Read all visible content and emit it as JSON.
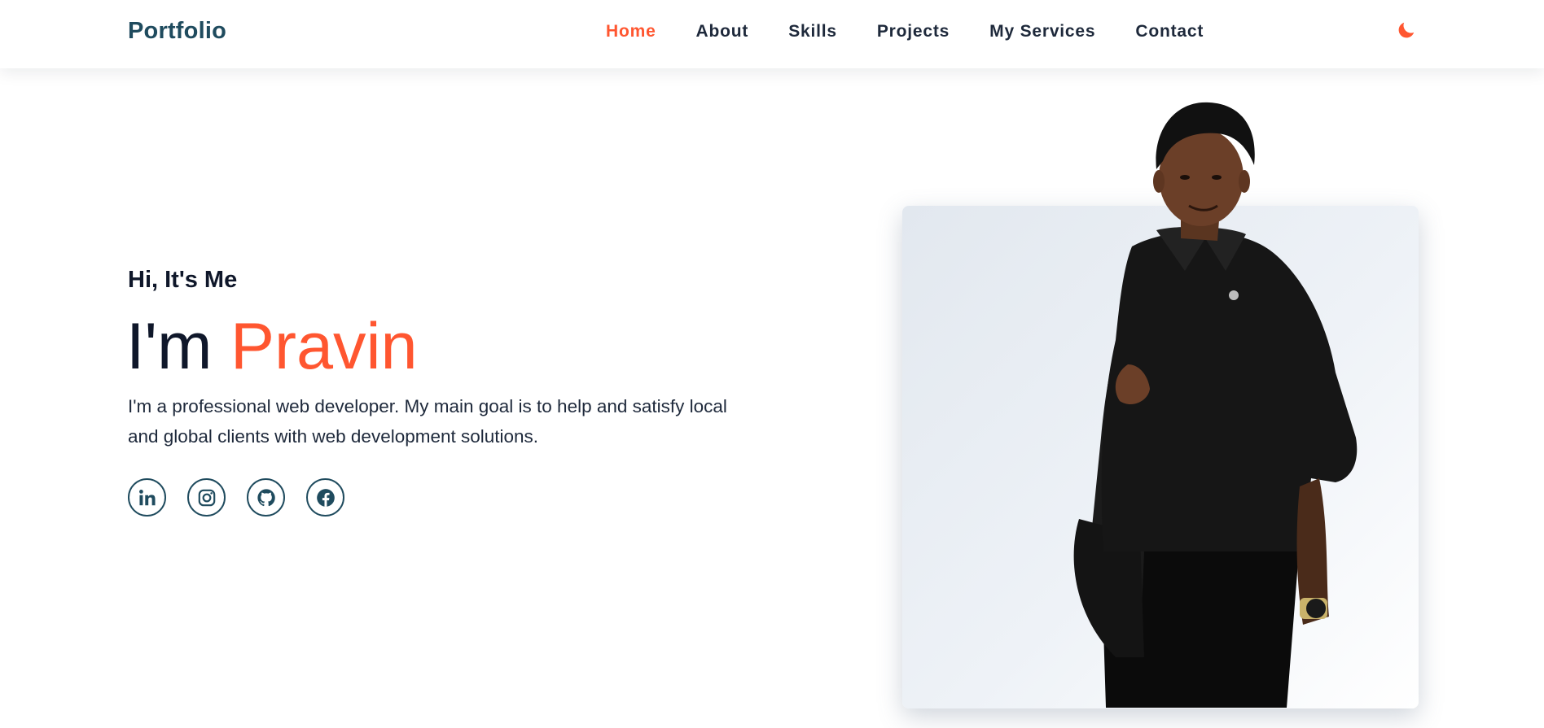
{
  "nav": {
    "logo": "Portfolio",
    "links": [
      {
        "label": "Home",
        "active": true
      },
      {
        "label": "About",
        "active": false
      },
      {
        "label": "Skills",
        "active": false
      },
      {
        "label": "Projects",
        "active": false
      },
      {
        "label": "My Services",
        "active": false
      },
      {
        "label": "Contact",
        "active": false
      }
    ],
    "theme_toggle_icon": "moon-icon"
  },
  "hero": {
    "greeting": "Hi, It's Me",
    "title_prefix": "I'm ",
    "name": "Pravin",
    "description": "I'm a professional web developer. My main goal is to help and satisfy local and global clients with web development solutions.",
    "socials": [
      {
        "icon": "linkedin-icon"
      },
      {
        "icon": "instagram-icon"
      },
      {
        "icon": "github-icon"
      },
      {
        "icon": "facebook-icon"
      }
    ],
    "photo_icon": "profile-photo"
  },
  "colors": {
    "accent": "#ff5630",
    "brand": "#1f4b5e",
    "text": "#0f172a"
  }
}
